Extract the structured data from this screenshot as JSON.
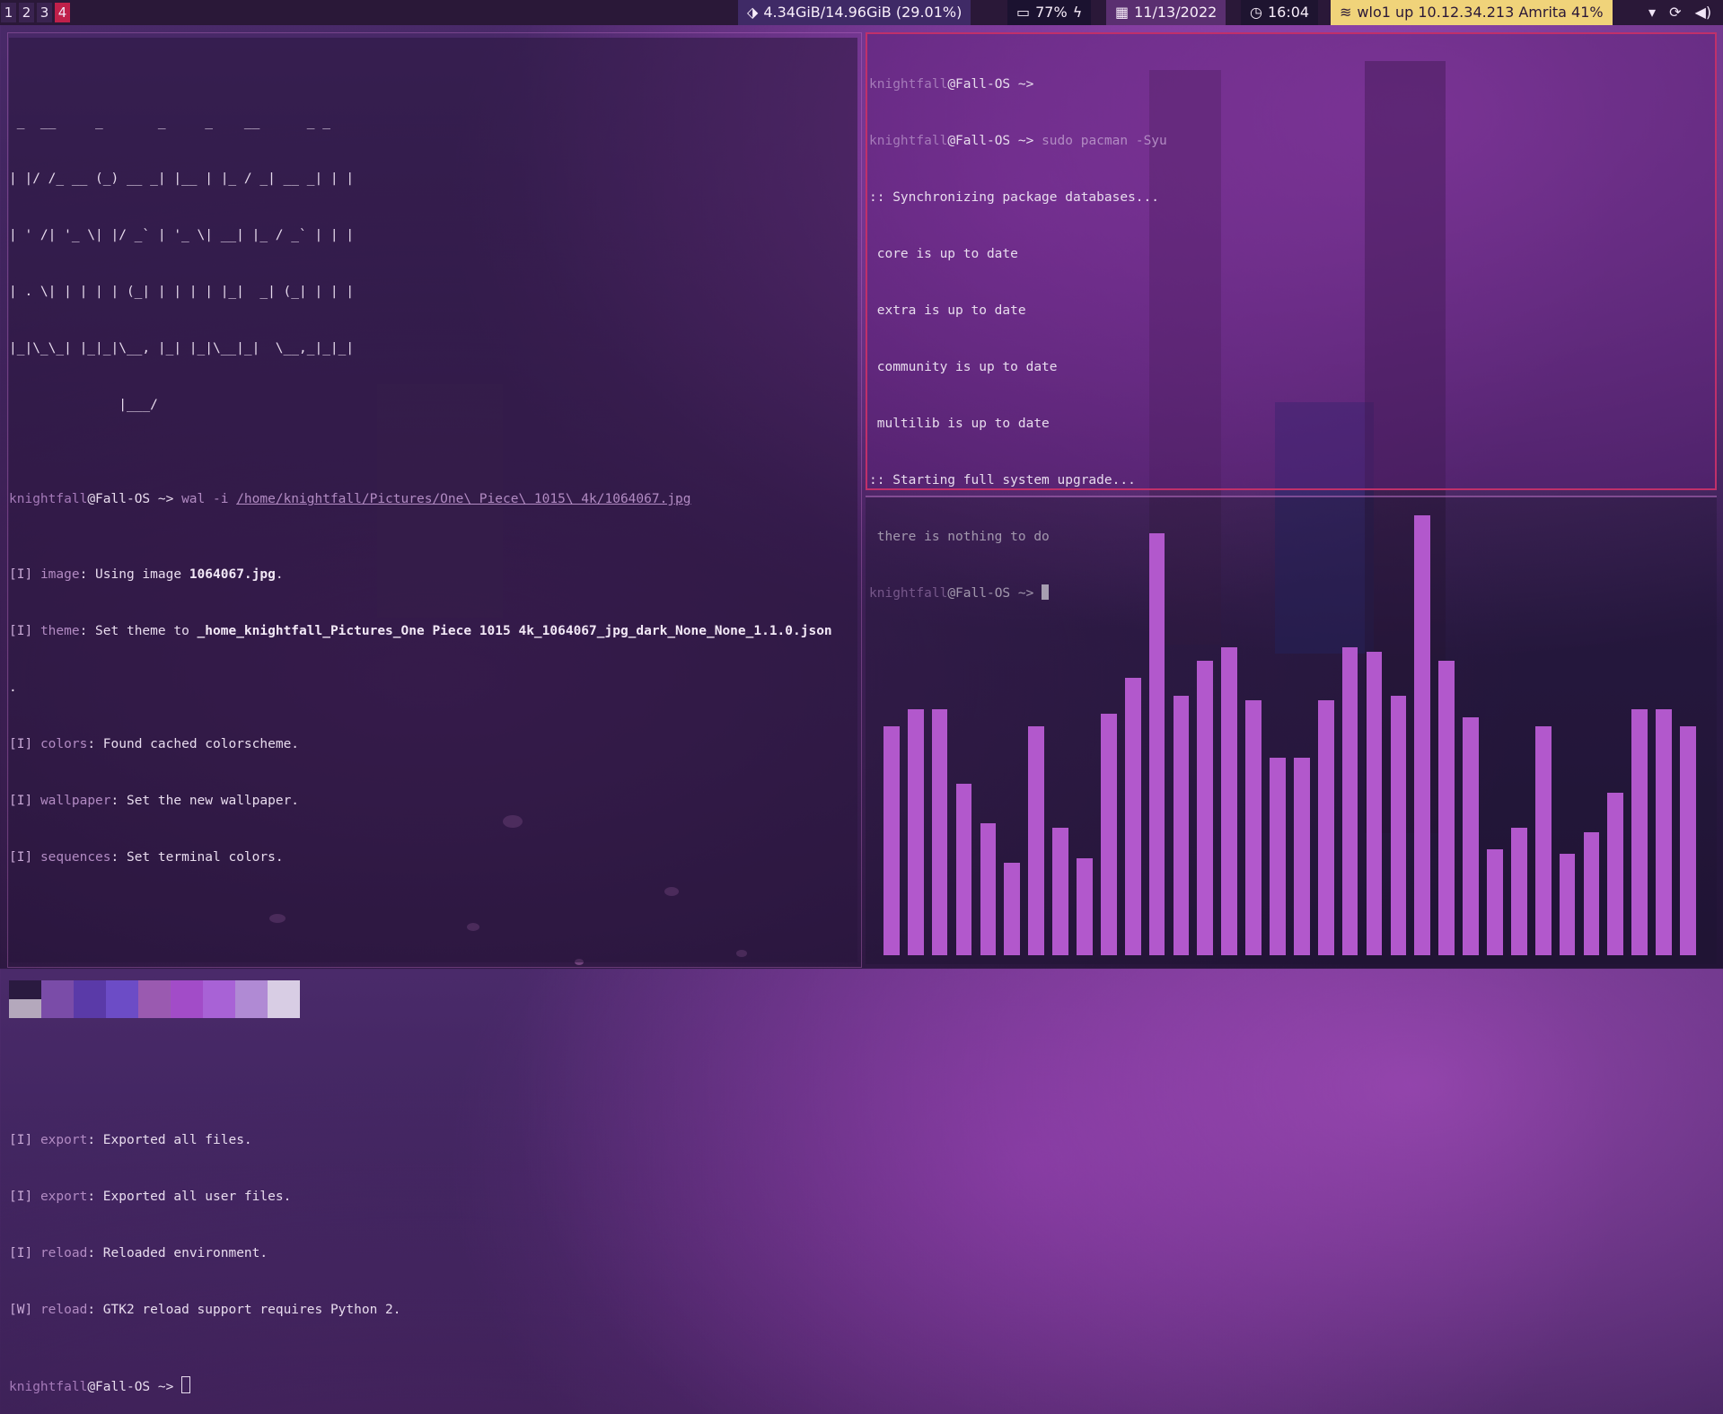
{
  "topbar": {
    "workspaces": [
      "1",
      "2",
      "3",
      "4"
    ],
    "disk": "4.34GiB/14.96GiB (29.01%)",
    "battery": "77%",
    "date": "11/13/2022",
    "time": "16:04",
    "network": "wlo1 up 10.12.34.213 Amrita 41%",
    "colors": {
      "bar_bg": "#2a1838",
      "disk_bg": "#3f2a66",
      "battery_bg": "#1b1230",
      "date_bg": "#5a2f70",
      "time_bg": "#1e1430",
      "net_bg": "#f0d37a",
      "active_ws": "#c0204a"
    }
  },
  "left_terminal": {
    "banner": [
      " _  __     _       _     _    __      _ _ ",
      "| |/ /_ __ (_) __ _| |__ | |_ / _| __ _| | |",
      "| ' /| '_ \\| |/ _` | '_ \\| __| |_ / _` | | |",
      "| . \\| | | | | (_| | | | | |_|  _| (_| | | |",
      "|_|\\_\\_| |_|_|\\__, |_| |_|\\__|_|  \\__,_|_|_|",
      "              |___/                         "
    ],
    "user": "knightfall",
    "host": "@Fall-OS",
    "arrow": " ~> ",
    "command": "wal -i ",
    "path": "/home/knightfall/Pictures/One\\ Piece\\ 1015\\ 4k/1064067.jpg",
    "output": [
      {
        "tag": "[I]",
        "key": "image",
        "text": ": Using image ",
        "bold": "1064067.jpg",
        "tail": "."
      },
      {
        "tag": "[I]",
        "key": "theme",
        "text": ": Set theme to ",
        "bold": "_home_knightfall_Pictures_One Piece 1015 4k_1064067_jpg_dark_None_None_1.1.0.json",
        "tail": ""
      },
      {
        "tag": "",
        "key": "",
        "text": ".",
        "bold": "",
        "tail": ""
      },
      {
        "tag": "[I]",
        "key": "colors",
        "text": ": Found cached colorscheme.",
        "bold": "",
        "tail": ""
      },
      {
        "tag": "[I]",
        "key": "wallpaper",
        "text": ": Set the new wallpaper.",
        "bold": "",
        "tail": ""
      },
      {
        "tag": "[I]",
        "key": "sequences",
        "text": ": Set terminal colors.",
        "bold": "",
        "tail": ""
      }
    ],
    "palette_top": [
      "#2a1a40",
      "#7a4ca8",
      "#5a3aa8",
      "#6c4cc6",
      "#9a5ab0",
      "#a24cc8",
      "#a862d6",
      "#b08ad4",
      "#d8cde4"
    ],
    "palette_bottom": [
      "#b4a8bc",
      "#7a4ca8",
      "#5a3aa8",
      "#6c4cc6",
      "#9a5ab0",
      "#a24cc8",
      "#a862d6",
      "#b08ad4",
      "#d8cde4"
    ],
    "output2": [
      {
        "tag": "[I]",
        "key": "export",
        "text": ": Exported all files."
      },
      {
        "tag": "[I]",
        "key": "export",
        "text": ": Exported all user files."
      },
      {
        "tag": "[I]",
        "key": "reload",
        "text": ": Reloaded environment."
      },
      {
        "tag": "[W]",
        "key": "reload",
        "text": ": GTK2 reload support requires Python 2."
      }
    ]
  },
  "right_terminal": {
    "user": "knightfall",
    "host": "@Fall-OS",
    "arrow": " ~>",
    "arrow2": " ~> ",
    "command": "sudo pacman -Syu",
    "lines": [
      ":: Synchronizing package databases...",
      " core is up to date",
      " extra is up to date",
      " community is up to date",
      " multilib is up to date",
      ":: Starting full system upgrade...",
      " there is nothing to do"
    ]
  },
  "visualizer": {
    "color": "#b258cc",
    "levels": [
      0.52,
      0.56,
      0.56,
      0.39,
      0.3,
      0.21,
      0.52,
      0.29,
      0.22,
      0.55,
      0.63,
      0.96,
      0.59,
      0.67,
      0.7,
      0.58,
      0.45,
      0.45,
      0.58,
      0.7,
      0.69,
      0.59,
      1.0,
      0.67,
      0.54,
      0.24,
      0.29,
      0.52,
      0.23,
      0.28,
      0.37,
      0.56,
      0.56,
      0.52
    ]
  }
}
